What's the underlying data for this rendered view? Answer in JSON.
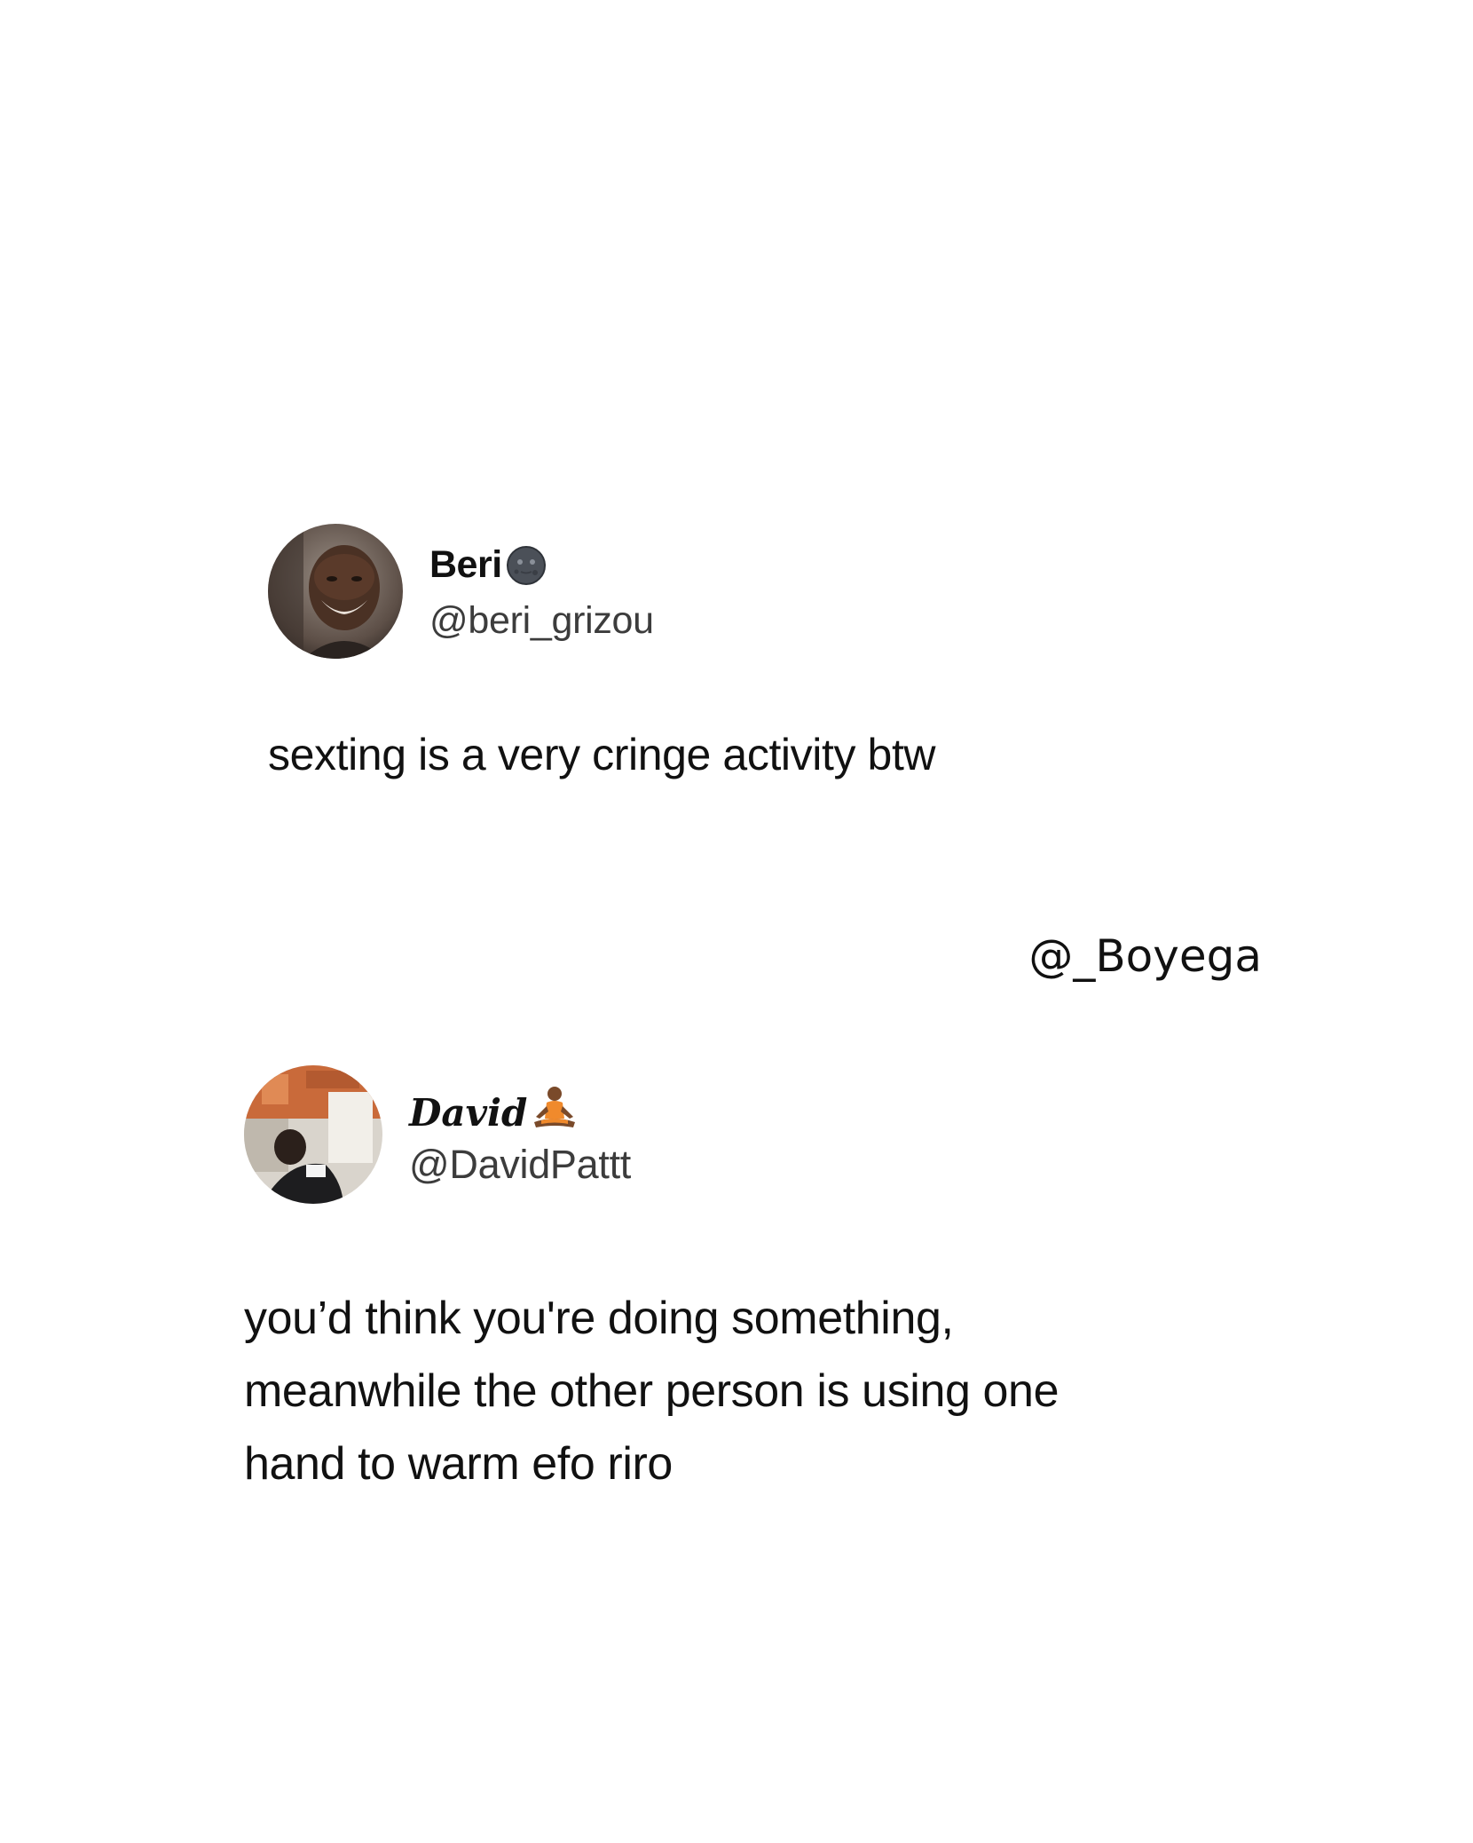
{
  "tweets": [
    {
      "display_name": "Beri",
      "name_emoji": "new-moon-face-emoji",
      "handle": "@beri_grizou",
      "avatar": "profile-photo",
      "text": "sexting is a very cringe activity btw"
    },
    {
      "display_name": "David",
      "name_emoji": "person-in-lotus-position-emoji",
      "handle": "@DavidPattt",
      "avatar": "profile-photo",
      "text_lines": [
        "you’d think you're doing something,",
        "meanwhile the other person is using one",
        "hand to warm efo riro"
      ]
    }
  ],
  "watermark": "@_Boyega",
  "colors": {
    "background": "#ffffff",
    "text": "#111111",
    "handle": "#3c3c3c"
  }
}
